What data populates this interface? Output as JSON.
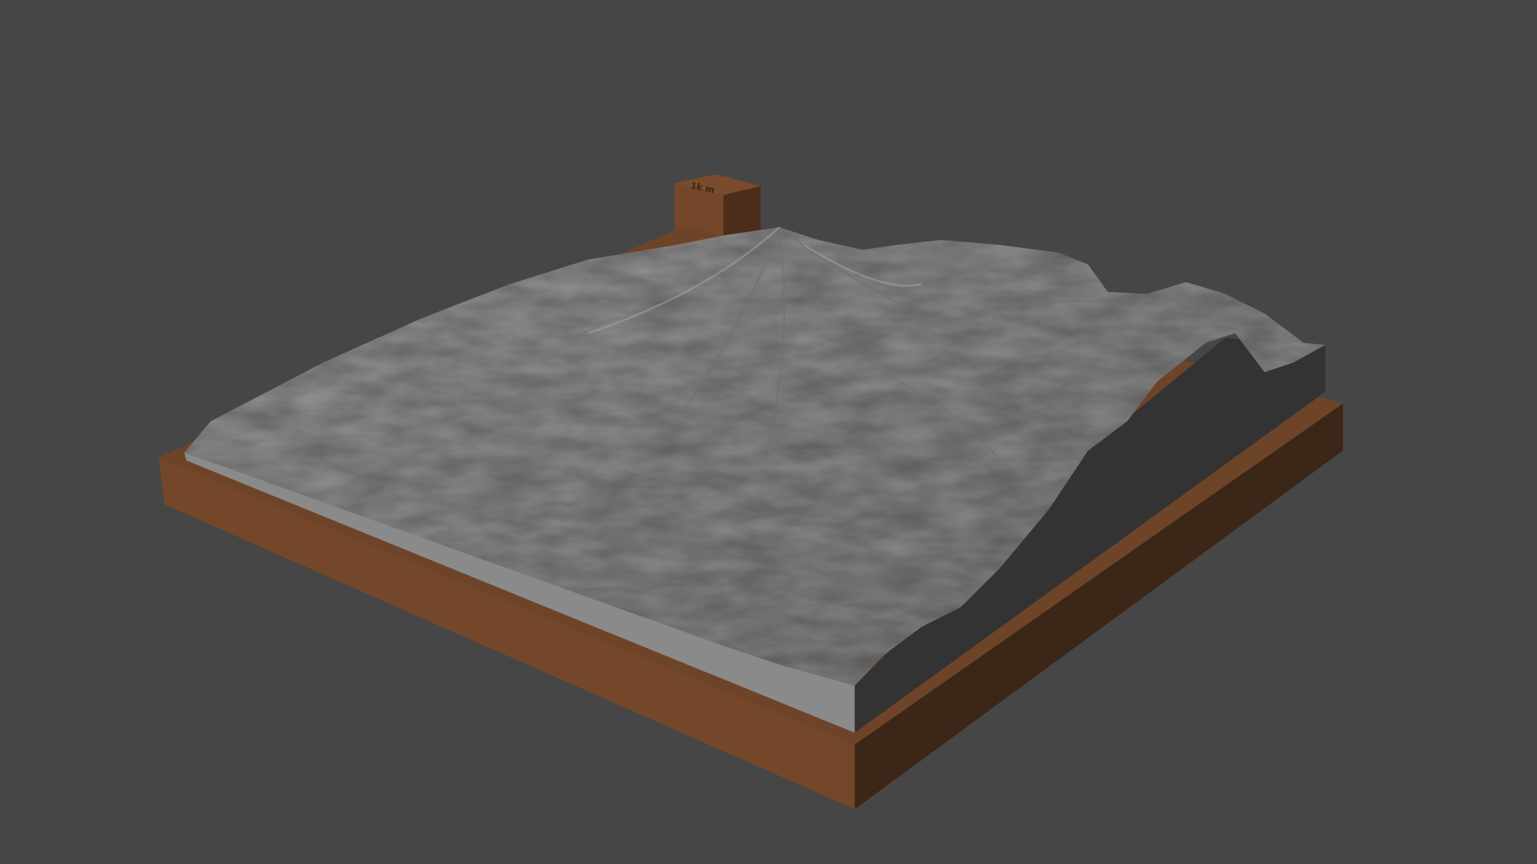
{
  "scene": {
    "subject": "terrain-relief-model",
    "scale_block_label": "1k m"
  },
  "colors": {
    "background": "#464646",
    "base_wood": "#74472a",
    "base_wood_shadow": "#3b2618",
    "terrain": "#8e8e8e",
    "slab_side_light": "#8a8a8a",
    "slab_side_dark": "#333333"
  }
}
